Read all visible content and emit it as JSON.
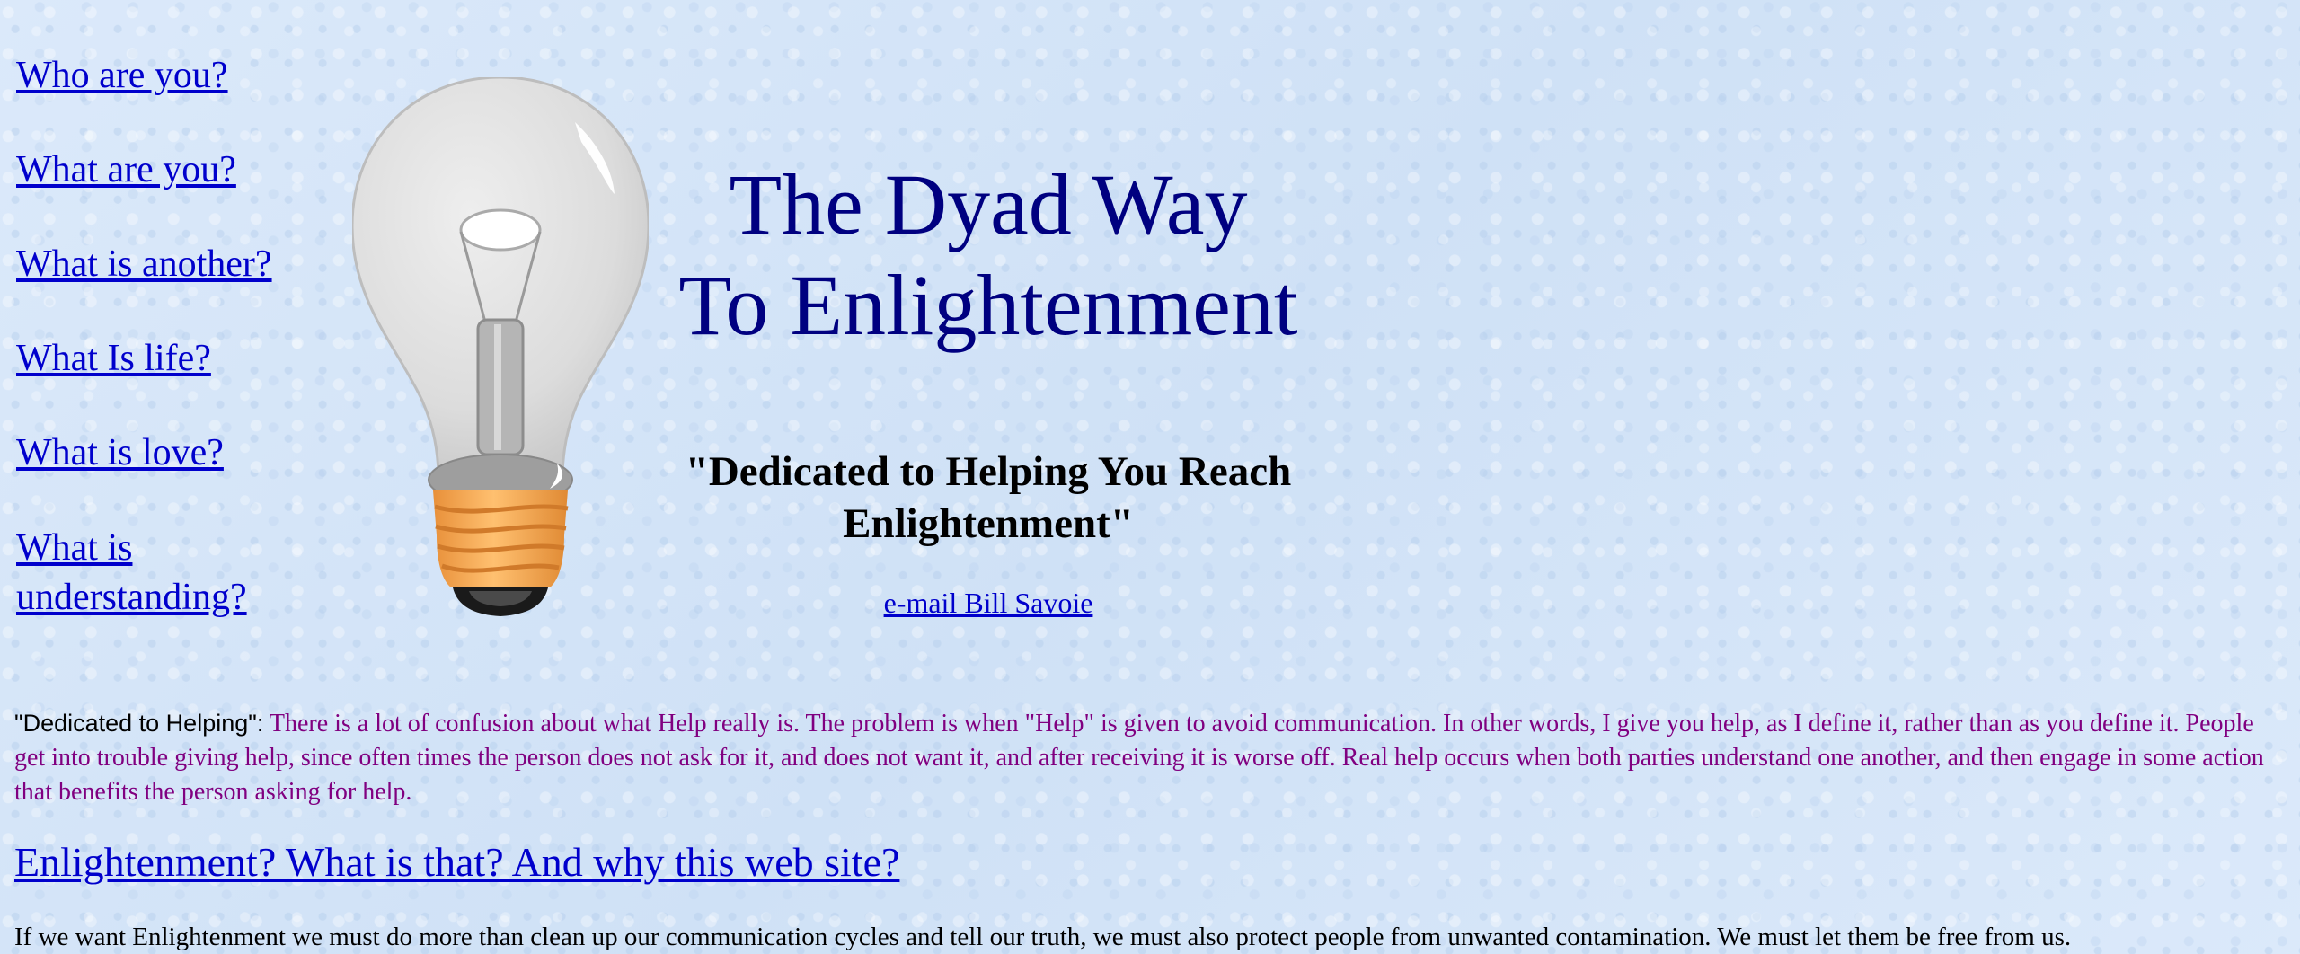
{
  "nav": {
    "items": [
      {
        "label": "Who are you?"
      },
      {
        "label": "What are you?"
      },
      {
        "label": "What is another?"
      },
      {
        "label": "What Is life?"
      },
      {
        "label": "What is love?"
      },
      {
        "label": "What is understanding?"
      }
    ]
  },
  "header": {
    "title_line1": "The Dyad Way",
    "title_line2": "To Enlightenment",
    "dedication": "\"Dedicated to Helping You Reach Enlightenment\"",
    "email_label": "e-mail Bill Savoie"
  },
  "intro": {
    "lead": "\"Dedicated to Helping\":",
    "body": " There is a lot of confusion about what Help really is. The problem is when \"Help\" is given to avoid communication. In other words, I give you help, as I define it, rather than as you define it. People get into trouble giving help, since often times the person does not ask for it, and does not want it, and after receiving it is worse off. Real help occurs when both parties understand one another, and then engage in some action that benefits the person asking for help."
  },
  "section": {
    "heading_link": "Enlightenment? What is that? And why this web site?",
    "text": "If we want Enlightenment we must do more than clean up our communication cycles and tell our truth, we must also protect people from unwanted contamination. We must let them be free from us."
  },
  "colors": {
    "background": "#d6e6f8",
    "title": "#000080",
    "link": "#0000cc",
    "body_text": "#800080"
  },
  "icons": {
    "bulb": "light-bulb-icon"
  }
}
